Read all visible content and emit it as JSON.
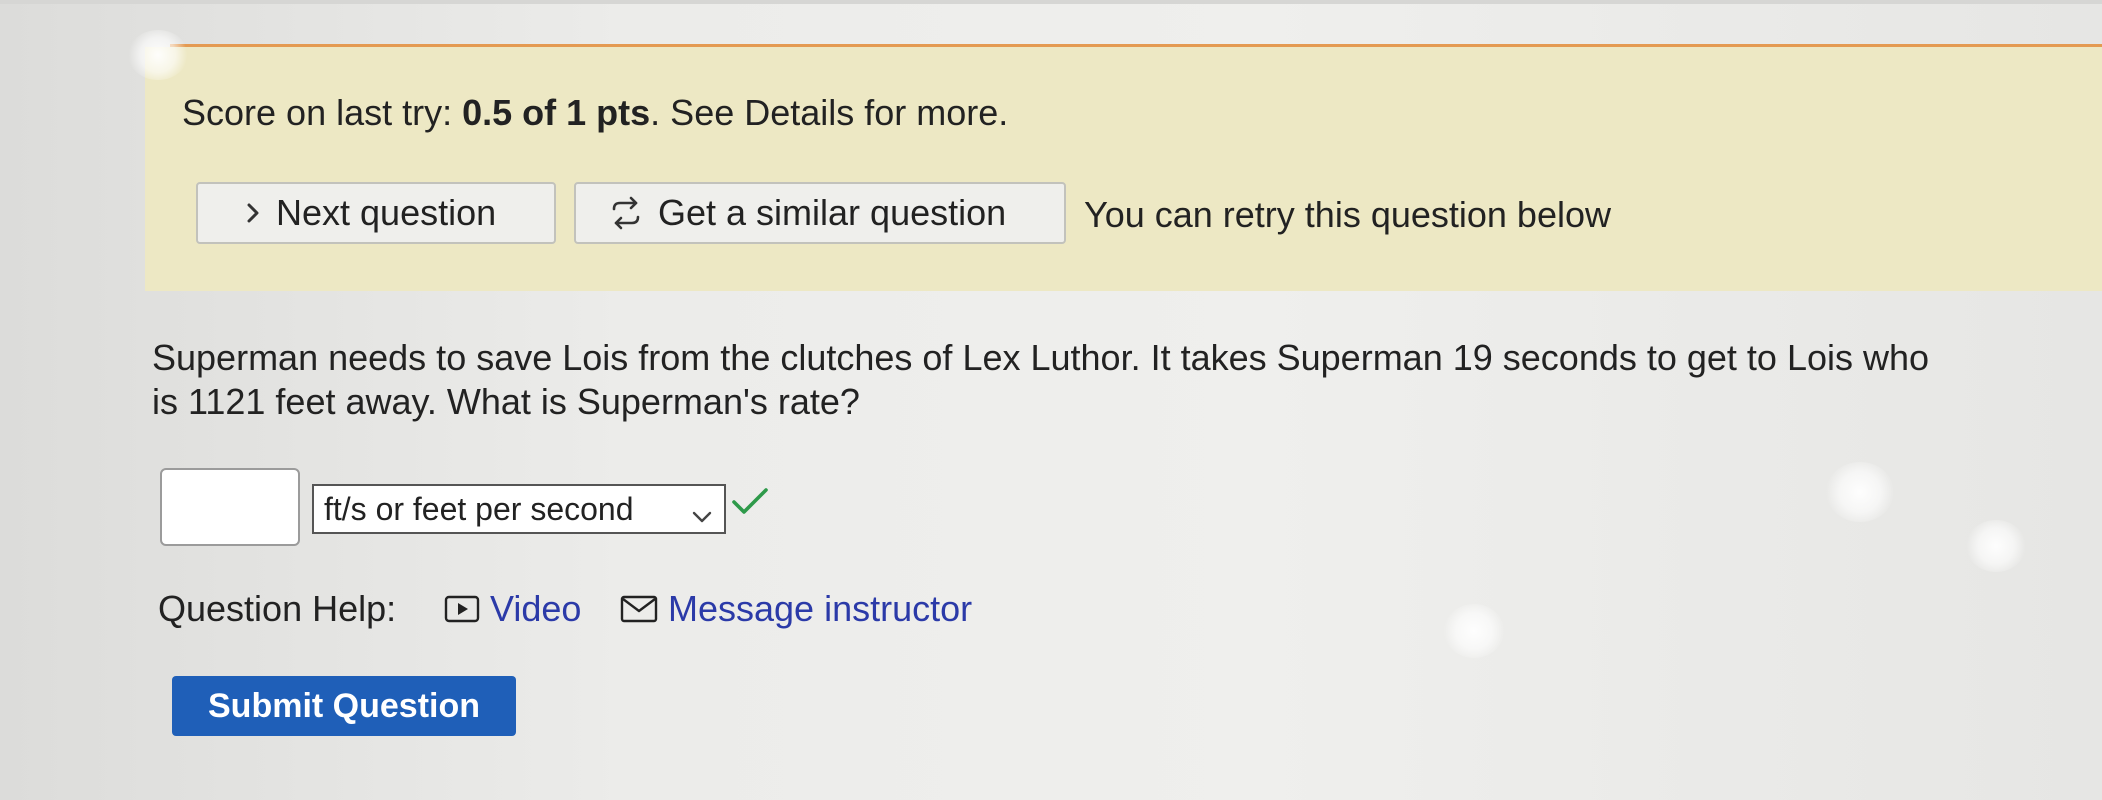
{
  "score": {
    "prefix": "Score on last try: ",
    "value": "0.5 of 1 pts",
    "suffix": ". See Details for more."
  },
  "actions": {
    "next_question": "Next question",
    "similar_question": "Get a similar question",
    "retry_note": "You can retry this question below"
  },
  "question": {
    "text": "Superman needs to save Lois from the clutches of Lex Luthor. It takes Superman 19 seconds to get to Lois who is 1121 feet away. What is Superman's rate?"
  },
  "answer": {
    "value": "",
    "unit_selected": "ft/s or feet per second"
  },
  "help": {
    "label": "Question Help:",
    "video": "Video",
    "message": "Message instructor"
  },
  "submit": {
    "label": "Submit Question"
  },
  "colors": {
    "panel_bg": "#ede8c4",
    "accent_rule": "#e49a52",
    "link": "#2b3aa8",
    "submit_bg": "#1f5fb8",
    "check": "#2e9a4a"
  },
  "icons": {
    "next": "chevron-right-icon",
    "similar": "refresh-arrows-icon",
    "video": "video-play-icon",
    "message": "envelope-icon",
    "select": "chevron-down-icon",
    "correct": "checkmark-icon"
  }
}
